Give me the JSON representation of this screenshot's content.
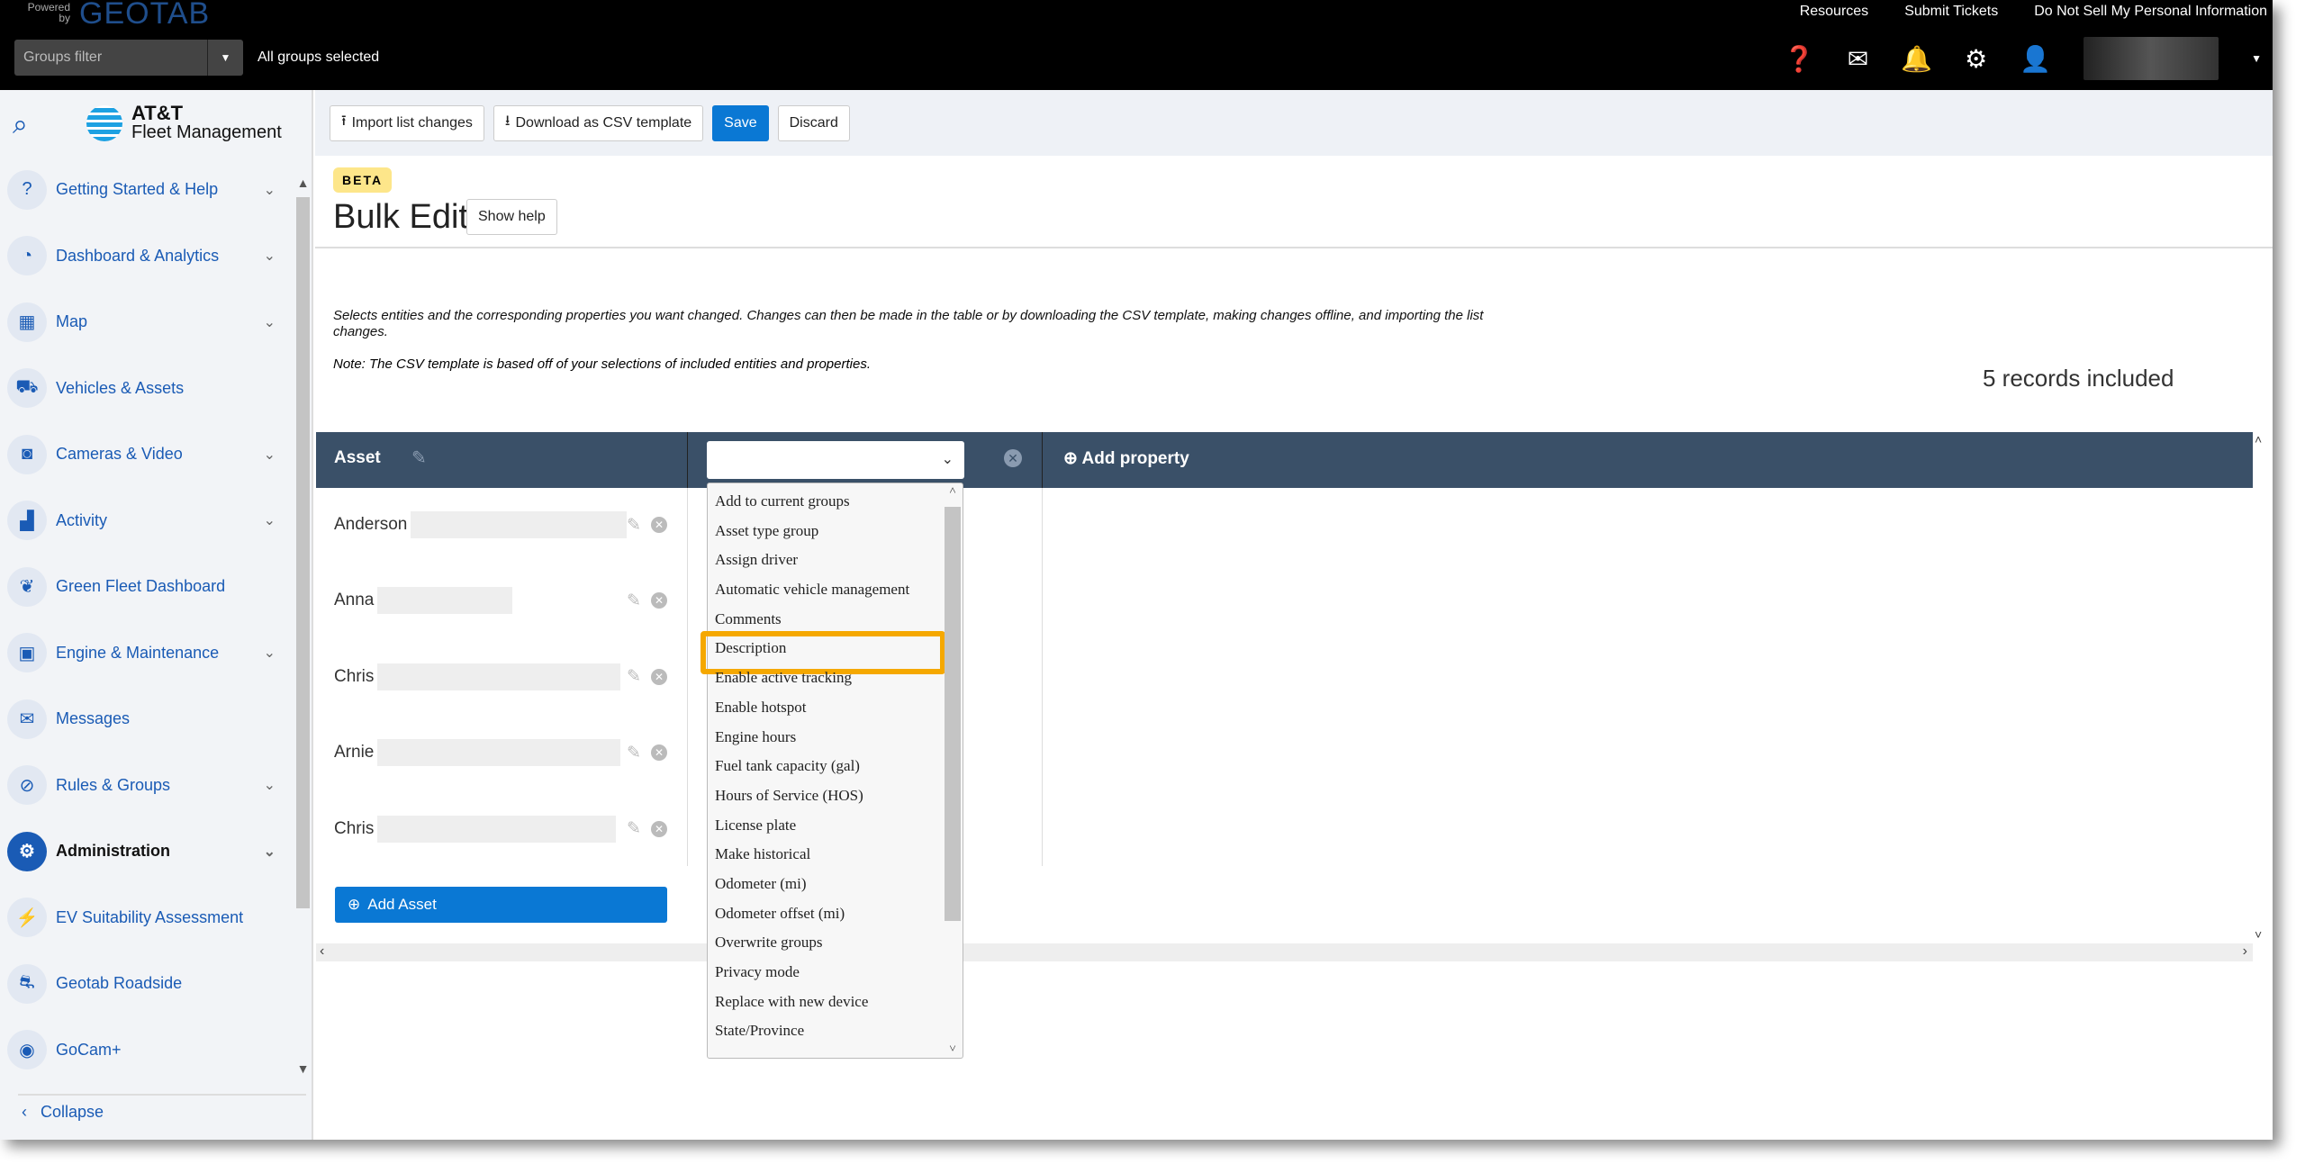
{
  "topbar": {
    "powered_by": "Powered by",
    "logo": "GEOTAB",
    "links": [
      "Resources",
      "Submit Tickets",
      "Do Not Sell My Personal Information"
    ],
    "groups_filter_placeholder": "Groups filter",
    "groups_status": "All groups selected"
  },
  "sidebar": {
    "brand_line1": "AT&T",
    "brand_line2": "Fleet Management",
    "items": [
      {
        "label": "Getting Started & Help",
        "icon": "help-icon",
        "chevron": true
      },
      {
        "label": "Dashboard & Analytics",
        "icon": "pie-chart-icon",
        "chevron": true
      },
      {
        "label": "Map",
        "icon": "map-icon",
        "chevron": true
      },
      {
        "label": "Vehicles & Assets",
        "icon": "truck-icon",
        "chevron": false
      },
      {
        "label": "Cameras & Video",
        "icon": "camera-icon",
        "chevron": true
      },
      {
        "label": "Activity",
        "icon": "activity-chart-icon",
        "chevron": true
      },
      {
        "label": "Green Fleet Dashboard",
        "icon": "leaf-icon",
        "chevron": false
      },
      {
        "label": "Engine & Maintenance",
        "icon": "engine-icon",
        "chevron": true
      },
      {
        "label": "Messages",
        "icon": "mail-icon",
        "chevron": false
      },
      {
        "label": "Rules & Groups",
        "icon": "rules-icon",
        "chevron": true
      },
      {
        "label": "Administration",
        "icon": "gear-icon",
        "chevron": true,
        "active": true
      },
      {
        "label": "EV Suitability Assessment",
        "icon": "ev-icon",
        "chevron": false
      },
      {
        "label": "Geotab Roadside",
        "icon": "roadside-icon",
        "chevron": false
      },
      {
        "label": "GoCam+",
        "icon": "gocam-icon",
        "chevron": false
      }
    ],
    "collapse": "Collapse"
  },
  "toolbar": {
    "import": "Import list changes",
    "download": "Download as CSV template",
    "save": "Save",
    "discard": "Discard"
  },
  "page": {
    "badge": "BETA",
    "title": "Bulk Edit",
    "show_help": "Show help",
    "description": "Selects entities and the corresponding properties you want changed. Changes can then be made in the table or by downloading the CSV template, making changes offline, and importing the list changes.",
    "note": "Note: The CSV template is based off of your selections of included entities and properties.",
    "records": "5 records included"
  },
  "table": {
    "asset_header": "Asset",
    "add_property": "Add property",
    "property_select_value": "",
    "rows": [
      "Anderson",
      "Anna",
      "Chris",
      "Arnie",
      "Chris"
    ],
    "add_asset": "Add Asset"
  },
  "dropdown": {
    "options": [
      "Add to current groups",
      "Asset type group",
      "Assign driver",
      "Automatic vehicle management",
      "Comments",
      "Description",
      "Enable active tracking",
      "Enable hotspot",
      "Engine hours",
      "Fuel tank capacity (gal)",
      "Hours of Service (HOS)",
      "License plate",
      "Make historical",
      "Odometer (mi)",
      "Odometer offset (mi)",
      "Overwrite groups",
      "Privacy mode",
      "Replace with new device",
      "State/Province"
    ],
    "highlighted": "Description",
    "highlight_color": "#f5a800"
  }
}
